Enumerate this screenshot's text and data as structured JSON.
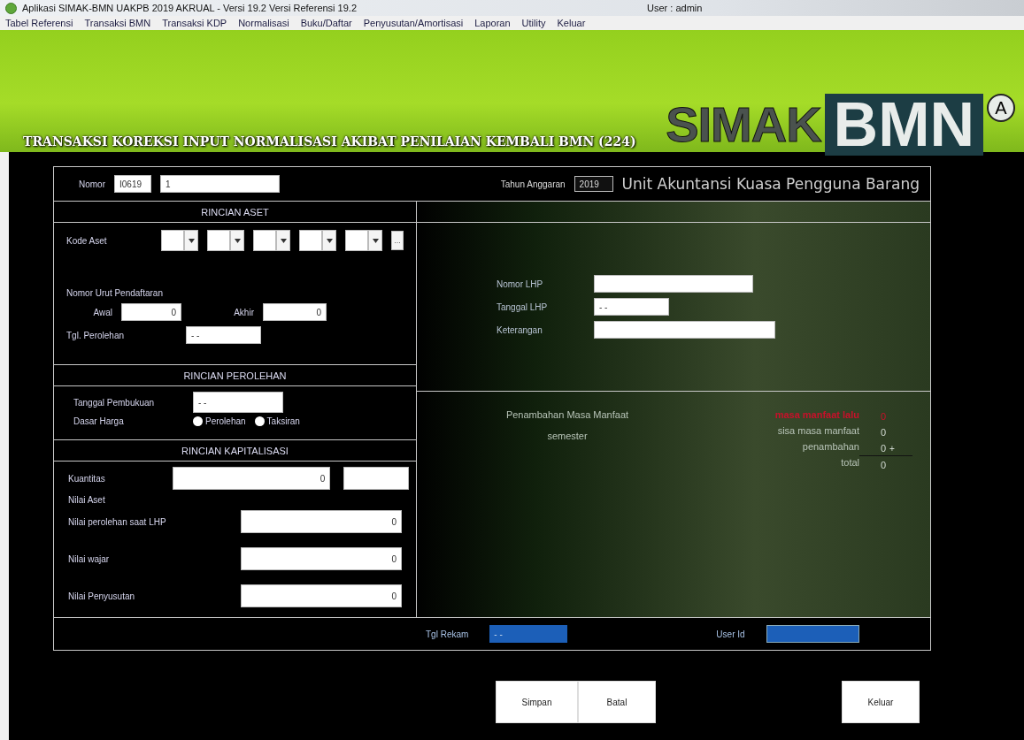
{
  "window": {
    "title": "Aplikasi SIMAK-BMN UAKPB 2019 AKRUAL -  Versi 19.2 Versi Referensi 19.2",
    "user": "User : admin"
  },
  "menu": [
    "Tabel Referensi",
    "Transaksi BMN",
    "Transaksi KDP",
    "Normalisasi",
    "Buku/Daftar",
    "Penyusutan/Amortisasi",
    "Laporan",
    "Utility",
    "Keluar"
  ],
  "banner": {
    "logo_left": "SIMAK",
    "logo_right": "BMN",
    "logo_badge": "A",
    "form_title": "TRANSAKSI KOREKSI INPUT NORMALISASI AKIBAT PENILAIAN KEMBALI BMN (224)",
    "subtitle": "Unit Akuntansi Kuasa Pengguna Barang",
    "year_label": "Tahun Anggaran",
    "year_value": "2019"
  },
  "nomor": {
    "label": "Nomor",
    "prefix": "I0619",
    "value": "1"
  },
  "rincian_aset": {
    "title": "RINCIAN ASET",
    "kode_label": "Kode Aset",
    "kode_parts": [
      {
        "kind": "combo"
      },
      {
        "kind": "combo"
      },
      {
        "kind": "combo"
      },
      {
        "kind": "combo"
      },
      {
        "kind": "combo"
      },
      {
        "kind": "browse",
        "label": "..."
      }
    ],
    "nup_label": "Nomor Urut Pendaftaran",
    "awal_label": "Awal",
    "awal": "0",
    "akhir_label": "Akhir",
    "akhir": "0",
    "tgl_label": "Tgl. Perolehan",
    "tgl": "- -"
  },
  "rincian_perolehan": {
    "title": "RINCIAN PEROLEHAN",
    "tanggal_label": "Tanggal Pembukuan",
    "tanggal": "- -",
    "dasar_label": "Dasar Harga",
    "options": [
      {
        "label": "Perolehan",
        "selected": false
      },
      {
        "label": "Taksiran",
        "selected": false
      }
    ]
  },
  "rincian_kapitalisasi": {
    "title": "RINCIAN KAPITALISASI",
    "kuantitas_label": "Kuantitas",
    "kuantitas": "0",
    "nilai_aset_label": "Nilai Aset",
    "fields": [
      {
        "label": "Nilai perolehan saat LHP",
        "value": "0"
      },
      {
        "label": "Nilai wajar",
        "value": "0"
      },
      {
        "label": "Nilai Penyusutan",
        "value": "0"
      }
    ]
  },
  "lhp": [
    {
      "label": "Nomor LHP"
    },
    {
      "label": "Tanggal LHP",
      "value": "- -"
    },
    {
      "label": "Keterangan"
    }
  ],
  "masa_manfaat": {
    "title": "Penambahan Masa Manfaat",
    "unit": "semester",
    "rows": [
      {
        "label": "masa manfaat lalu",
        "value": "0",
        "highlight": true
      },
      {
        "label": "sisa masa manfaat",
        "value": "0",
        "highlight": false
      },
      {
        "label": "penambahan",
        "value": "0",
        "highlight": false,
        "operator": "+"
      },
      {
        "label": "total",
        "value": "0",
        "highlight": false
      }
    ]
  },
  "record": {
    "tgl_label": "Tgl Rekam",
    "tgl": "- -",
    "user_label": "User Id"
  },
  "buttons_left": [
    "Simpan",
    "Batal"
  ],
  "buttons_right": [
    "Keluar"
  ]
}
